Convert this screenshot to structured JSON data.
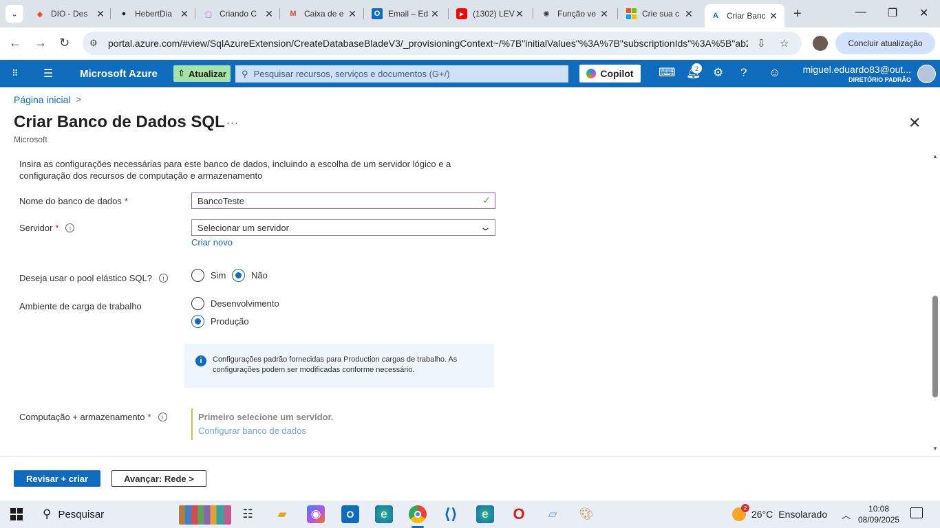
{
  "browser": {
    "tabs": [
      {
        "title": "DIO - Des",
        "icon": "figma-icon",
        "color": "#f24e1e"
      },
      {
        "title": "HebertDia",
        "icon": "github-icon",
        "color": "#1b1f23"
      },
      {
        "title": "Criando C",
        "icon": "app-icon",
        "color": "#a855f7"
      },
      {
        "title": "Caixa de e",
        "icon": "gmail-icon",
        "color": "#ea4335"
      },
      {
        "title": "Email – Ed",
        "icon": "outlook-icon",
        "color": "#0f6cbd"
      },
      {
        "title": "(1302) LEV",
        "icon": "youtube-icon",
        "color": "#ff0000"
      },
      {
        "title": "Função ve",
        "icon": "chatgpt-icon",
        "color": "#333333"
      },
      {
        "title": "Crie sua c",
        "icon": "microsoft-icon",
        "color": "#f25022"
      },
      {
        "title": "Criar Banc",
        "icon": "azure-icon",
        "color": "#0f6cbd"
      }
    ],
    "url": "portal.azure.com/#view/SqlAzureExtension/CreateDatabaseBladeV3/_provisioningContext~/%7B\"initialValues\"%3A%7B\"subscriptionIds\"%3A%5B\"ab2...",
    "update_label": "Concluir atualização"
  },
  "azure": {
    "brand": "Microsoft Azure",
    "upgrade_label": "Atualizar",
    "search_placeholder": "Pesquisar recursos, serviços e documentos (G+/)",
    "copilot_label": "Copilot",
    "notifications_count": "2",
    "user_email": "miguel.eduardo83@out...",
    "user_directory": "DIRETÓRIO PADRÃO"
  },
  "page": {
    "breadcrumb_home": "Página inicial",
    "title": "Criar Banco de Dados SQL",
    "subtitle": "Microsoft",
    "more": "···"
  },
  "form": {
    "intro": "Insira as configurações necessárias para este banco de dados, incluindo a escolha de um servidor lógico e a configuração dos recursos de computação e armazenamento",
    "db_name_label": "Nome do banco de dados",
    "db_name_value": "BancoTeste",
    "server_label": "Servidor",
    "server_placeholder": "Selecionar um servidor",
    "create_new": "Criar novo",
    "elastic_label": "Deseja usar o pool elástico SQL?",
    "elastic_yes": "Sim",
    "elastic_no": "Não",
    "workload_label": "Ambiente de carga de trabalho",
    "workload_dev": "Desenvolvimento",
    "workload_prod": "Produção",
    "info_text": "Configurações padrão fornecidas para Production cargas de trabalho. As configurações podem ser modificadas conforme necessário.",
    "compute_label": "Computação + armazenamento",
    "compute_msg": "Primeiro selecione um servidor.",
    "compute_link": "Configurar banco de dados",
    "required_mark": "*"
  },
  "footer": {
    "review_create": "Revisar + criar",
    "next": "Avançar: Rede >"
  },
  "taskbar": {
    "search_label": "Pesquisar",
    "weather_temp": "26°C",
    "weather_desc": "Ensolarado",
    "weather_badge": "2",
    "time": "10:08",
    "date": "08/09/2025"
  }
}
